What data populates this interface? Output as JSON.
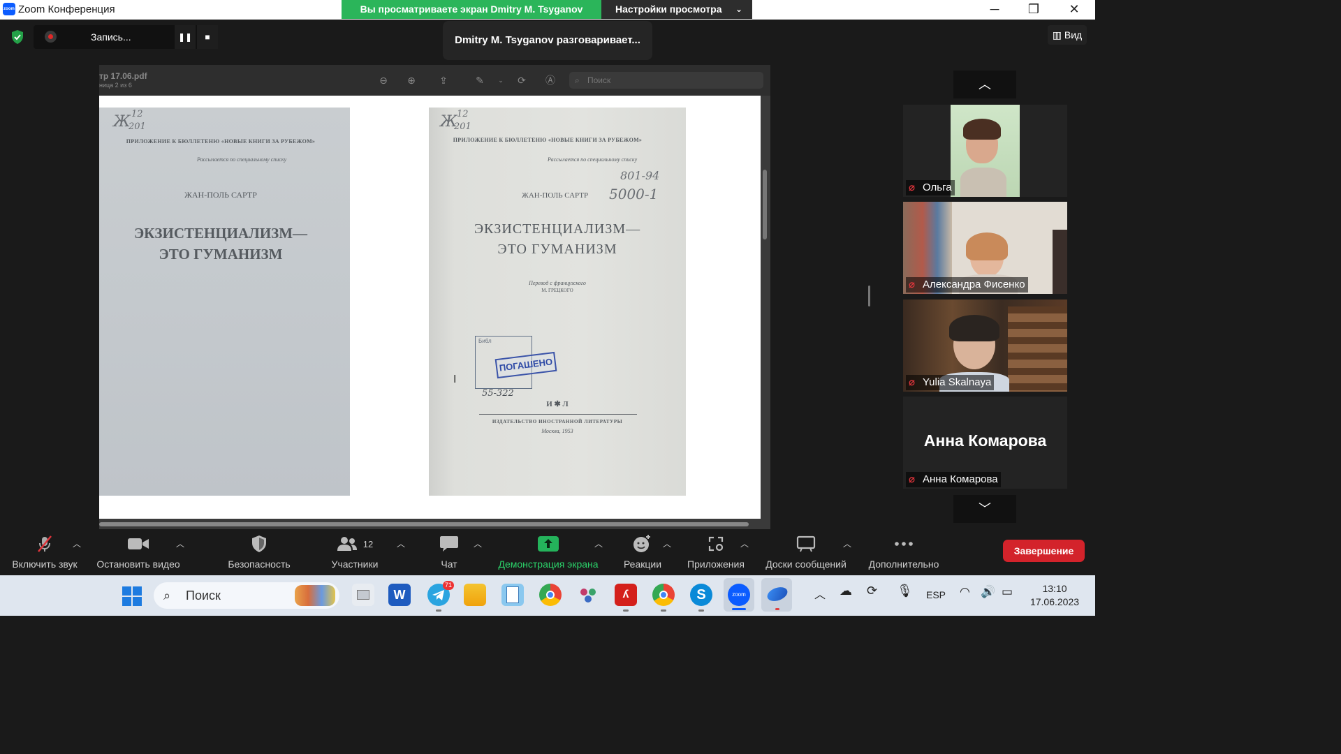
{
  "window": {
    "title": "Zoom Конференция",
    "app_icon": "zoom",
    "share_banner": "Вы просматриваете экран Dmitry M. Tsyganov",
    "view_settings": "Настройки просмотра",
    "controls": [
      "minimize-icon",
      "restore-icon",
      "close-icon"
    ]
  },
  "topbar": {
    "recording_label": "Запись...",
    "speaker_notice": "Dmitry M. Tsyganov разговаривает...",
    "view_label": "Вид"
  },
  "pdf": {
    "filename": "тр 17.06.pdf",
    "page_info": "ница 2 из 6",
    "search_placeholder": "Поиск",
    "left_page": {
      "hand_id": "Ж",
      "hand_num_top": "12",
      "hand_num_bottom": "201",
      "supplement": "ПРИЛОЖЕНИЕ К БЮЛЛЕТЕНЮ «НОВЫЕ КНИГИ ЗА РУБЕЖОМ»",
      "distribution": "Рассылается по специальному списку",
      "author": "ЖАН-ПОЛЬ САРТР",
      "title_line1": "ЭКЗИСТЕНЦИАЛИЗМ—",
      "title_line2": "ЭТО ГУМАНИЗМ"
    },
    "right_page": {
      "hand_id": "Ж",
      "hand_num_top": "12",
      "hand_num_bottom": "201",
      "supplement": "ПРИЛОЖЕНИЕ К БЮЛЛЕТЕНЮ «НОВЫЕ КНИГИ ЗА РУБЕЖОМ»",
      "distribution": "Рассылается по специальному списку",
      "author": "ЖАН-ПОЛЬ САРТР",
      "hand_code1": "801-94",
      "hand_code2": "5000-1",
      "title_line1": "ЭКЗИСТЕНЦИАЛИЗМ—",
      "title_line2": "ЭТО ГУМАНИЗМ",
      "translation_line1": "Перевод с французского",
      "translation_line2": "М. ГРЕЦКОГО",
      "stamp_text": "ПОГАШЕНО",
      "stamp_small": "Библ",
      "stamp_number": "55-322",
      "imprint_mark": "И ✱ Л",
      "publisher": "ИЗДАТЕЛЬСТВО ИНОСТРАННОЙ ЛИТЕРАТУРЫ",
      "city_year": "Москва, 1953"
    }
  },
  "gallery": {
    "participants": [
      {
        "name": "Ольга",
        "video": true
      },
      {
        "name": "Александра Фисенко",
        "video": true
      },
      {
        "name": "Yulia Skalnaya",
        "video": true
      },
      {
        "name": "Анна Комарова",
        "video": false,
        "display_name": "Анна Комарова"
      }
    ]
  },
  "toolbar": {
    "unmute": "Включить звук",
    "stop_video": "Остановить видео",
    "security": "Безопасность",
    "participants": "Участники",
    "participants_count": "12",
    "chat": "Чат",
    "share_screen": "Демонстрация экрана",
    "reactions": "Реакции",
    "apps": "Приложения",
    "whiteboards": "Доски сообщений",
    "more": "Дополнительно",
    "end": "Завершение"
  },
  "taskbar": {
    "search": "Поиск",
    "telegram_badge": "71",
    "language": "ESP",
    "time": "13:10",
    "date": "17.06.2023"
  },
  "colors": {
    "share_green": "#2bb55a",
    "end_red": "#d3232b",
    "zoom_blue": "#0b5cff",
    "mic_off_red": "#e0343b"
  }
}
